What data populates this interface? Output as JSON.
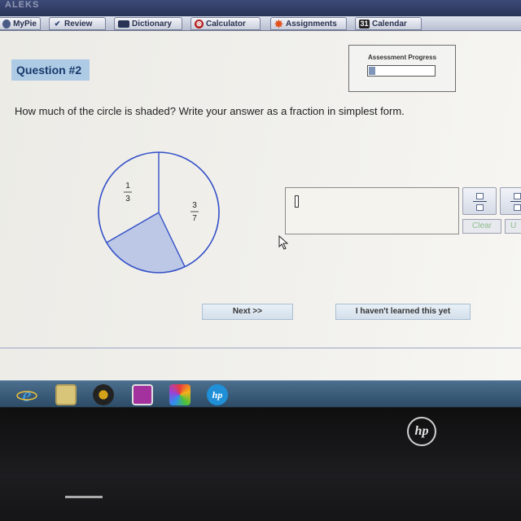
{
  "app": {
    "logo_text": "ALEKS",
    "nav_tabs": [
      {
        "label": "MyPie",
        "icon": "pie-icon"
      },
      {
        "label": "Review",
        "icon": "checkmark-icon"
      },
      {
        "label": "Dictionary",
        "icon": "book-icon"
      },
      {
        "label": "Calculator",
        "icon": "calculator-icon"
      },
      {
        "label": "Assignments",
        "icon": "star-icon"
      },
      {
        "label": "Calendar",
        "icon": "calendar-icon",
        "icon_text": "31"
      }
    ]
  },
  "question": {
    "badge": "Question #2",
    "prompt": "How much of the circle is shaded? Write your answer as a fraction in simplest form."
  },
  "progress": {
    "label": "Assessment Progress",
    "fraction": 0.1
  },
  "pie": {
    "segments": [
      {
        "numerator": "1",
        "denominator": "3",
        "shaded": false
      },
      {
        "numerator": "3",
        "denominator": "7",
        "shaded": false
      },
      {
        "shaded": true
      }
    ],
    "shaded_color": "#bcc8e6",
    "stroke_color": "#3350c8"
  },
  "answer": {
    "value": "",
    "tools": {
      "fraction_tool": "fraction-icon",
      "mixed_number_tool": "mixed-number-icon",
      "clear_label": "Clear",
      "undo_label": "U"
    }
  },
  "buttons": {
    "next": "Next >>",
    "not_learned": "I haven't learned this yet"
  },
  "taskbar": {
    "items": [
      "internet-explorer-icon",
      "file-explorer-icon",
      "media-player-icon",
      "remote-desktop-icon",
      "photo-gallery-icon",
      "hp-support-icon"
    ]
  },
  "device": {
    "brand_logo": "hp"
  }
}
